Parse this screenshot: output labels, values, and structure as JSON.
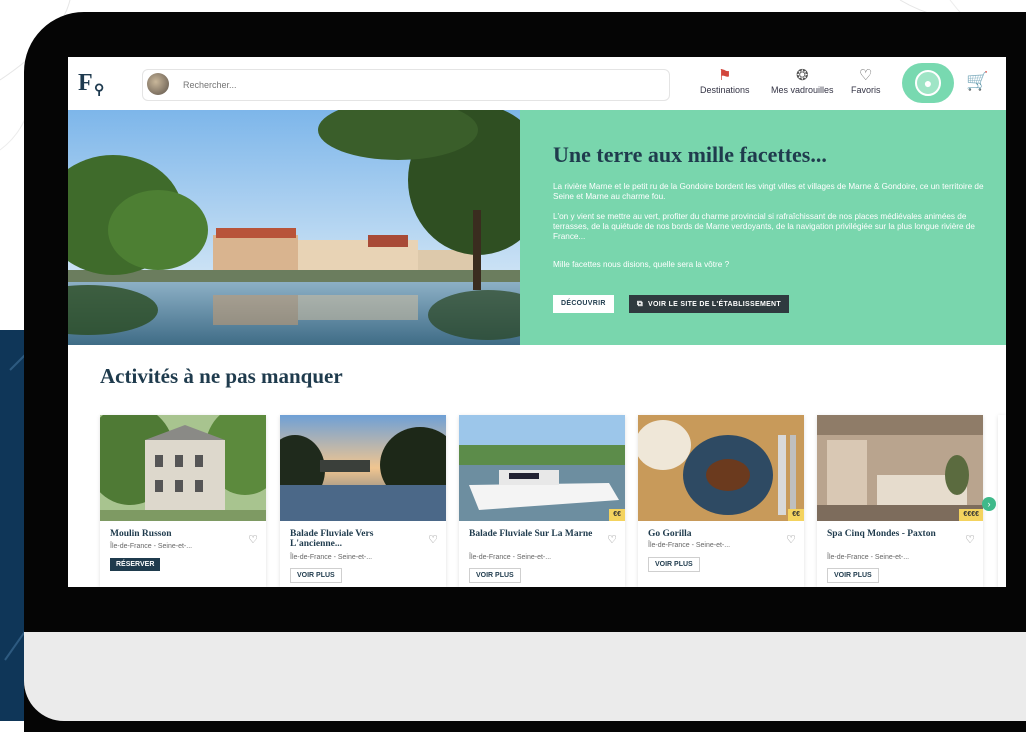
{
  "header": {
    "search": {
      "placeholder": "Rechercher..."
    },
    "nav": [
      {
        "label": "Destinations",
        "icon": "flag-icon"
      },
      {
        "label": "Mes vadrouilles",
        "icon": "shell-icon"
      },
      {
        "label": "Favoris",
        "icon": "heart-icon"
      }
    ],
    "user_icon": "user-icon",
    "cart_icon": "cart-icon"
  },
  "hero": {
    "title": "Une terre aux mille facettes...",
    "paragraphs": [
      "La rivière Marne et le petit ru de la Gondoire bordent les vingt villes et villages de Marne & Gondoire, ce un territoire de Seine et Marne au charme fou.",
      "L'on y vient se mettre au vert, profiter du charme provincial si rafraîchissant de nos places médiévales animées de terrasses, de la quiétude de nos bords de Marne verdoyants, de la navigation privilégiée sur la plus longue rivière de France...",
      "Mille facettes nous disions, quelle sera la vôtre ?"
    ],
    "discover_label": "DÉCOUVRIR",
    "site_label": "VOIR LE SITE DE L'ÉTABLISSEMENT"
  },
  "activities": {
    "title": "Activités à ne pas manquer",
    "cards": [
      {
        "title": "Moulin Russon",
        "location": "Île-de-France - Seine-et-...",
        "button": "RÉSERVER",
        "tag": ""
      },
      {
        "title": "Balade Fluviale Vers L'ancienne...",
        "location": "Île-de-France - Seine-et-...",
        "button": "VOIR PLUS",
        "tag": ""
      },
      {
        "title": "Balade Fluviale Sur La Marne",
        "location": "Île-de-France - Seine-et-...",
        "button": "VOIR PLUS",
        "tag": "€€"
      },
      {
        "title": "Go Gorilla",
        "location": "Île-de-France - Seine-et-...",
        "button": "VOIR PLUS",
        "tag": "€€"
      },
      {
        "title": "Spa Cinq Mondes - Paxton",
        "location": "Île-de-France - Seine-et-...",
        "button": "VOIR PLUS",
        "tag": "€€€€"
      }
    ]
  },
  "colors": {
    "accent_green": "#79d6ad",
    "brand_navy": "#1f3b4d",
    "tablet_frame": "#050505"
  }
}
